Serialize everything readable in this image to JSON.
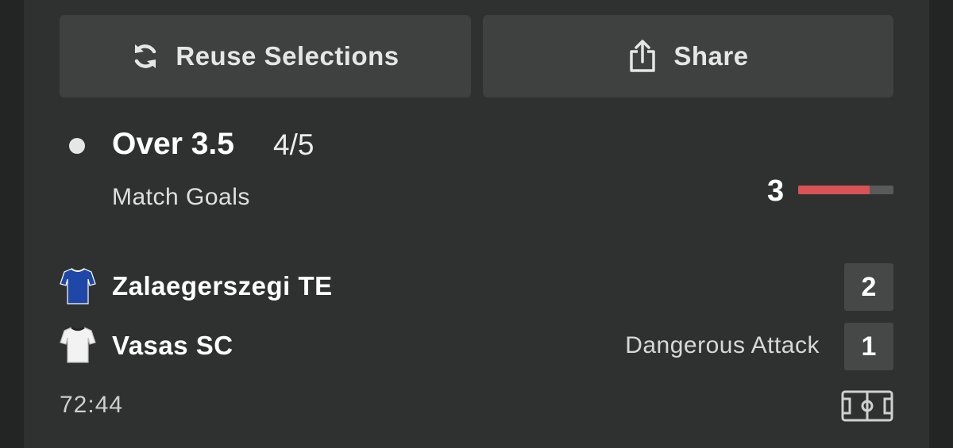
{
  "actions": {
    "reuse_label": "Reuse Selections",
    "share_label": "Share"
  },
  "selection": {
    "name": "Over 3.5",
    "odds": "4/5",
    "market": "Match Goals",
    "progress_value": "3",
    "progress_fraction": 0.75,
    "progress_color": "#d85356"
  },
  "match": {
    "home": {
      "team": "Zalaegerszegi TE",
      "score": "2",
      "kit_color": "#1f47a8"
    },
    "away": {
      "team": "Vasas SC",
      "score": "1",
      "kit_color": "#f2f2f2",
      "event": "Dangerous Attack"
    },
    "clock": "72:44"
  },
  "icons": {
    "reuse": "refresh-icon",
    "share": "share-icon",
    "pitch": "pitch-icon"
  }
}
